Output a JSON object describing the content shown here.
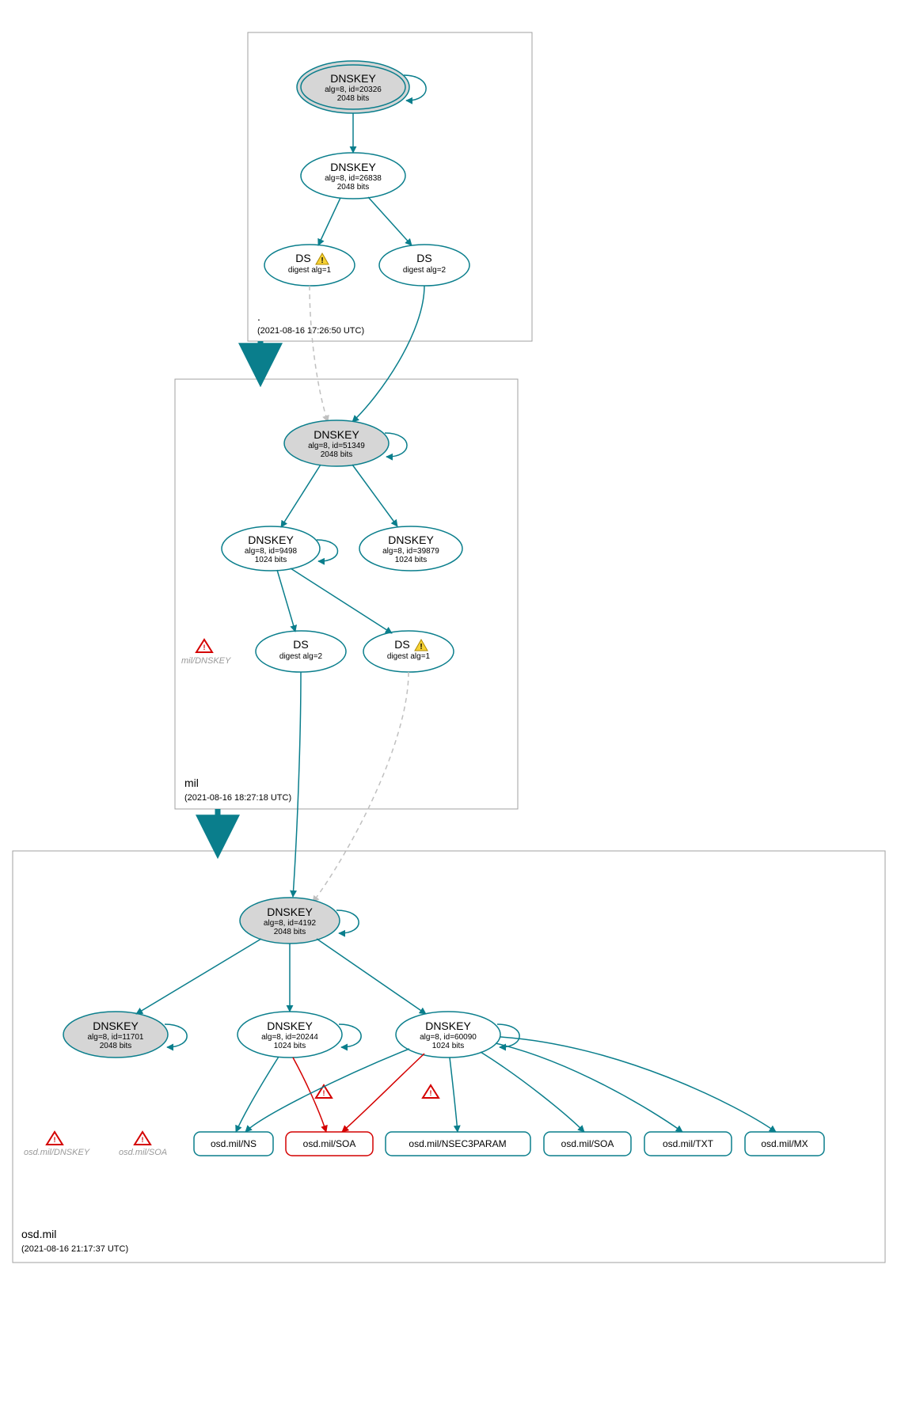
{
  "zones": {
    "root": {
      "name": ".",
      "timestamp": "(2021-08-16 17:26:50 UTC)",
      "nodes": {
        "ksk": {
          "title": "DNSKEY",
          "line1": "alg=8, id=20326",
          "line2": "2048 bits"
        },
        "zsk": {
          "title": "DNSKEY",
          "line1": "alg=8, id=26838",
          "line2": "2048 bits"
        },
        "ds1": {
          "title": "DS",
          "line1": "digest alg=1"
        },
        "ds2": {
          "title": "DS",
          "line1": "digest alg=2"
        }
      }
    },
    "mil": {
      "name": "mil",
      "timestamp": "(2021-08-16 18:27:18 UTC)",
      "nodes": {
        "ksk": {
          "title": "DNSKEY",
          "line1": "alg=8, id=51349",
          "line2": "2048 bits"
        },
        "zsk1": {
          "title": "DNSKEY",
          "line1": "alg=8, id=9498",
          "line2": "1024 bits"
        },
        "zsk2": {
          "title": "DNSKEY",
          "line1": "alg=8, id=39879",
          "line2": "1024 bits"
        },
        "ds1": {
          "title": "DS",
          "line1": "digest alg=2"
        },
        "ds2": {
          "title": "DS",
          "line1": "digest alg=1"
        }
      },
      "warnings": {
        "dnskey": "mil/DNSKEY"
      }
    },
    "osd": {
      "name": "osd.mil",
      "timestamp": "(2021-08-16 21:17:37 UTC)",
      "nodes": {
        "ksk": {
          "title": "DNSKEY",
          "line1": "alg=8, id=4192",
          "line2": "2048 bits"
        },
        "k2": {
          "title": "DNSKEY",
          "line1": "alg=8, id=11701",
          "line2": "2048 bits"
        },
        "k3": {
          "title": "DNSKEY",
          "line1": "alg=8, id=20244",
          "line2": "1024 bits"
        },
        "k4": {
          "title": "DNSKEY",
          "line1": "alg=8, id=60090",
          "line2": "1024 bits"
        }
      },
      "rrsets": {
        "ns": "osd.mil/NS",
        "soa1": "osd.mil/SOA",
        "nsec3": "osd.mil/NSEC3PARAM",
        "soa2": "osd.mil/SOA",
        "txt": "osd.mil/TXT",
        "mx": "osd.mil/MX"
      },
      "warnings": {
        "dnskey": "osd.mil/DNSKEY",
        "soa": "osd.mil/SOA"
      }
    }
  },
  "colors": {
    "teal": "#0a7e8c",
    "grey": "#d6d6d6",
    "red": "#d40000",
    "box": "#a0a0a0"
  }
}
